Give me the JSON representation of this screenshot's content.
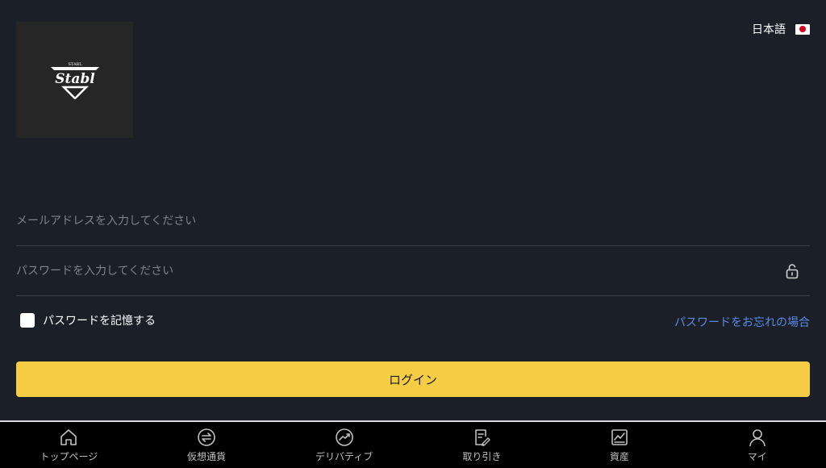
{
  "logo": {
    "brand_text": "Stabl",
    "small_text": "STABL"
  },
  "language": {
    "label": "日本語",
    "flag_icon": "japan-flag"
  },
  "email_field": {
    "placeholder": "メールアドレスを入力してください",
    "value": ""
  },
  "password_field": {
    "placeholder": "パスワードを入力してください",
    "value": "",
    "toggle_icon": "lock-icon"
  },
  "remember": {
    "label": "パスワードを記憶する",
    "checked": false
  },
  "forgot_link": {
    "label": "パスワードをお忘れの場合",
    "color": "#5b8be6"
  },
  "login_button": {
    "label": "ログイン",
    "color": "#f5cd45"
  },
  "tabbar": {
    "tabs": [
      {
        "label": "トップページ",
        "icon": "home-icon"
      },
      {
        "label": "仮想通貨",
        "icon": "exchange-icon"
      },
      {
        "label": "デリバティブ",
        "icon": "trend-icon"
      },
      {
        "label": "取り引き",
        "icon": "document-edit-icon"
      },
      {
        "label": "資産",
        "icon": "chart-icon"
      },
      {
        "label": "マイ",
        "icon": "user-icon"
      }
    ]
  },
  "colors": {
    "background": "#1b1f27",
    "tabbar_background": "#000000"
  }
}
